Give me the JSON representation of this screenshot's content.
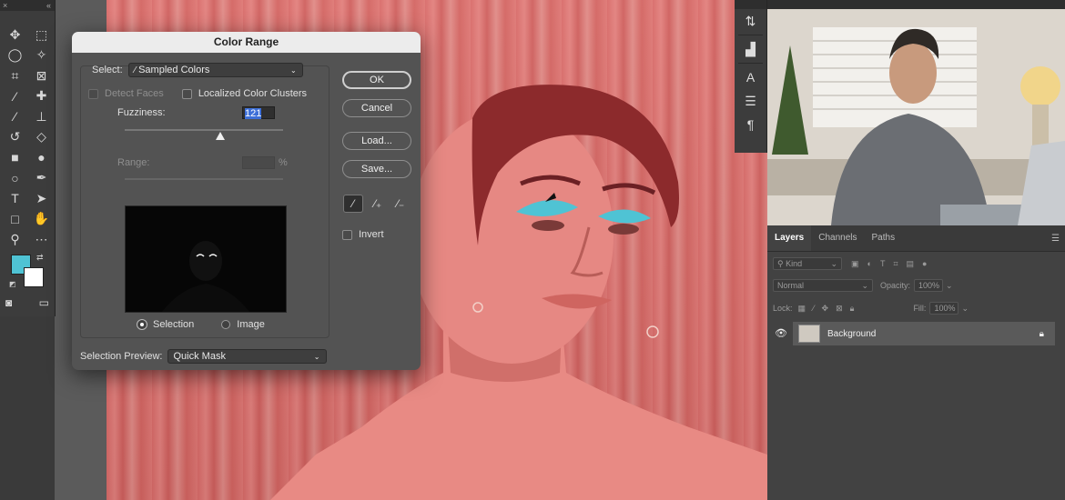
{
  "toolbar": {
    "close_glyph": "×",
    "collapse_glyph": "«",
    "tools": [
      {
        "icon": "move-icon",
        "glyph": "✥"
      },
      {
        "icon": "marquee-icon",
        "glyph": "⬚"
      },
      {
        "icon": "lasso-icon",
        "glyph": "◯"
      },
      {
        "icon": "magic-wand-icon",
        "glyph": "✧"
      },
      {
        "icon": "crop-icon",
        "glyph": "⌗"
      },
      {
        "icon": "frame-icon",
        "glyph": "⊠"
      },
      {
        "icon": "eyedropper-icon",
        "glyph": "⁄"
      },
      {
        "icon": "healing-brush-icon",
        "glyph": "✚"
      },
      {
        "icon": "brush-icon",
        "glyph": "⁄"
      },
      {
        "icon": "stamp-icon",
        "glyph": "⊥"
      },
      {
        "icon": "history-brush-icon",
        "glyph": "↺"
      },
      {
        "icon": "eraser-icon",
        "glyph": "◇"
      },
      {
        "icon": "gradient-icon",
        "glyph": "■"
      },
      {
        "icon": "blur-icon",
        "glyph": "●"
      },
      {
        "icon": "dodge-icon",
        "glyph": "○"
      },
      {
        "icon": "pen-icon",
        "glyph": "✒"
      },
      {
        "icon": "type-icon",
        "glyph": "T"
      },
      {
        "icon": "path-selection-icon",
        "glyph": "➤"
      },
      {
        "icon": "rectangle-icon",
        "glyph": "□"
      },
      {
        "icon": "hand-icon",
        "glyph": "✋"
      },
      {
        "icon": "zoom-icon",
        "glyph": "⚲"
      },
      {
        "icon": "more-tools-icon",
        "glyph": "⋯"
      }
    ],
    "foreground_color": "#4fc3d4",
    "background_color": "#ffffff"
  },
  "dialog": {
    "title": "Color Range",
    "select_label": "Select:",
    "select_value": "Sampled Colors",
    "detect_faces": "Detect Faces",
    "localized": "Localized Color Clusters",
    "fuzziness_label": "Fuzziness:",
    "fuzziness_value": "121",
    "range_label": "Range:",
    "range_unit": "%",
    "radio_selection": "Selection",
    "radio_image": "Image",
    "preview_label": "Selection Preview:",
    "preview_value": "Quick Mask",
    "ok": "OK",
    "cancel": "Cancel",
    "load": "Load...",
    "save": "Save...",
    "invert": "Invert"
  },
  "layers_panel": {
    "tabs": [
      "Layers",
      "Channels",
      "Paths"
    ],
    "kind_label": "Kind",
    "blend_mode": "Normal",
    "opacity_label": "Opacity:",
    "opacity_value": "100%",
    "lock_label": "Lock:",
    "fill_label": "Fill:",
    "fill_value": "100%",
    "layer_name": "Background"
  },
  "colors": {
    "canvas_overlay": "#d86a68",
    "eyeshadow": "#4fc3d4"
  }
}
